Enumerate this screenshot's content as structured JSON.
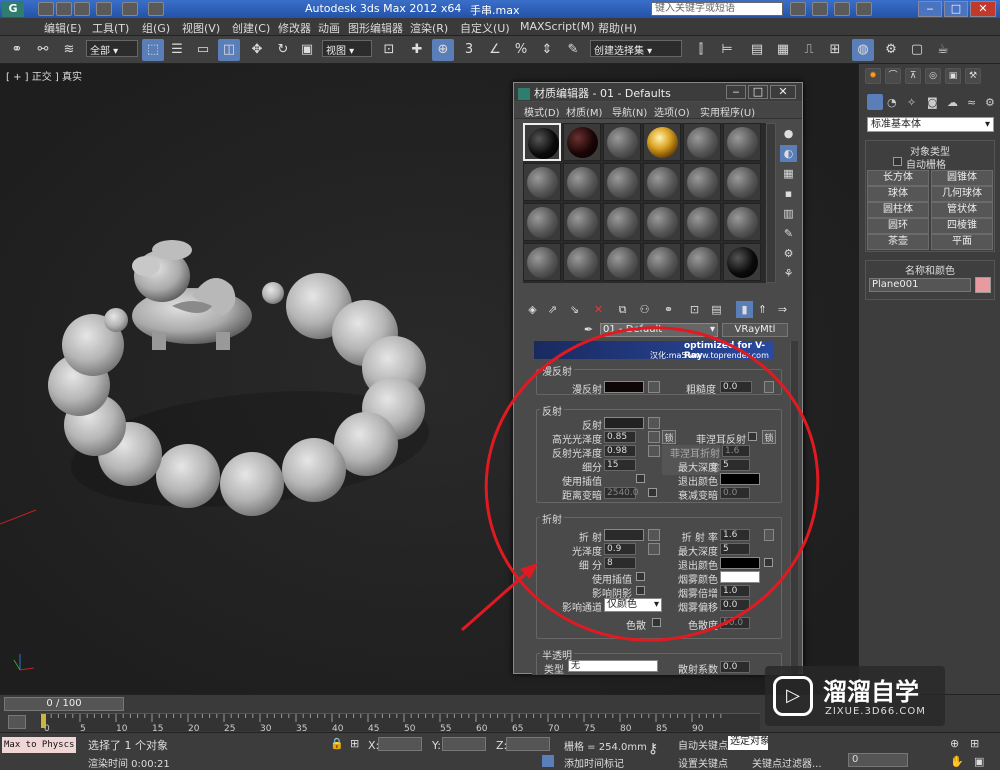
{
  "app": {
    "title": "Autodesk 3ds Max  2012 x64",
    "file": "手串.max",
    "search_placeholder": "键入关键字或短语"
  },
  "menu": [
    "编辑(E)",
    "工具(T)",
    "组(G)",
    "视图(V)",
    "创建(C)",
    "修改器",
    "动画",
    "图形编辑器",
    "渲染(R)",
    "自定义(U)",
    "MAXScript(M)",
    "帮助(H)"
  ],
  "toolbar": {
    "filter": "全部",
    "ref_coord": "视图",
    "snap_label": "3",
    "selset": "创建选择集"
  },
  "viewport": {
    "label": "[ + ] 正交 ] 真实"
  },
  "cmd": {
    "category": "标准基本体",
    "objtype_header": "对象类型",
    "autogrid": "自动栅格",
    "buttons": [
      "长方体",
      "圆锥体",
      "球体",
      "几何球体",
      "圆柱体",
      "管状体",
      "圆环",
      "四棱锥",
      "茶壶",
      "平面"
    ],
    "name_header": "名称和颜色",
    "name_value": "Plane001",
    "obj_color": "#e89aa0"
  },
  "mat": {
    "title": "材质编辑器 - 01 - Defaults",
    "menu": [
      "模式(D)",
      "材质(M)",
      "导航(N)",
      "选项(O)",
      "实用程序(U)"
    ],
    "mat_name": "01 - Default",
    "mat_type": "VRayMtl",
    "banner_top": "optimized for V-Ray",
    "banner_bot": "汉化:ma5 www.toprender.com",
    "diffuse": {
      "group": "漫反射",
      "diffuse_label": "漫反射",
      "rough_label": "粗糙度",
      "rough": "0.0"
    },
    "reflect": {
      "group": "反射",
      "refl": "反射",
      "hilight_gloss": "高光光泽度",
      "hilight_val": "0.85",
      "lock": "锁",
      "fresnel": "菲涅耳反射",
      "refl_gloss": "反射光泽度",
      "refl_gloss_val": "0.98",
      "fresnel_ior": "菲涅耳折射率",
      "fresnel_ior_val": "1.6",
      "subdiv": "细分",
      "subdiv_val": "15",
      "max_depth": "最大深度",
      "max_depth_val": "5",
      "interp": "使用插值",
      "exit_color": "退出颜色",
      "dim_dist": "距离变暗",
      "dim_dist_val": "2540.0",
      "dim_falloff": "衰减变暗",
      "dim_falloff_val": "0.0"
    },
    "refract": {
      "group": "折射",
      "refr": "折 射",
      "ior": "折 射 率",
      "ior_val": "1.6",
      "gloss": "光泽度",
      "gloss_val": "0.9",
      "max_depth": "最大深度",
      "max_depth_val": "5",
      "subdiv": "细 分",
      "subdiv_val": "8",
      "exit_color": "退出颜色",
      "interp": "使用插值",
      "fog_color": "烟雾颜色",
      "shadows": "影响阴影",
      "fog_mult": "烟雾倍增",
      "fog_mult_val": "1.0",
      "channels": "影响通道",
      "channels_val": "仅颜色",
      "fog_bias": "烟雾偏移",
      "fog_bias_val": "0.0",
      "disp": "色散",
      "abbe": "色散度",
      "abbe_val": "50.0"
    },
    "translucent": {
      "group": "半透明",
      "type": "类型",
      "type_val": "无",
      "scatter": "散射系数",
      "scatter_val": "0.0"
    }
  },
  "timeline": {
    "frame": "0 / 100",
    "ticks": [
      "0",
      "5",
      "10",
      "15",
      "20",
      "25",
      "30",
      "35",
      "40",
      "45",
      "50",
      "55",
      "60",
      "65",
      "70",
      "75",
      "80",
      "85",
      "90"
    ]
  },
  "status": {
    "script": "Max to Physcs (",
    "selected": "选择了 1 个对象",
    "render_time": "渲染时间  0:00:21",
    "x": "X:",
    "y": "Y:",
    "z": "Z:",
    "grid": "栅格 = 254.0mm",
    "add_tag": "添加时间标记",
    "auto_key": "自动关键点",
    "set_key": "设置关键点",
    "sel_obj": "选定对象",
    "key_filters": "关键点过滤器...",
    "frame_val": "0"
  },
  "watermark": {
    "name": "溜溜自学",
    "url": "ZIXUE.3D66.COM"
  },
  "colors": {
    "annotation": "#e11a22",
    "accent": "#5a7eb8"
  }
}
